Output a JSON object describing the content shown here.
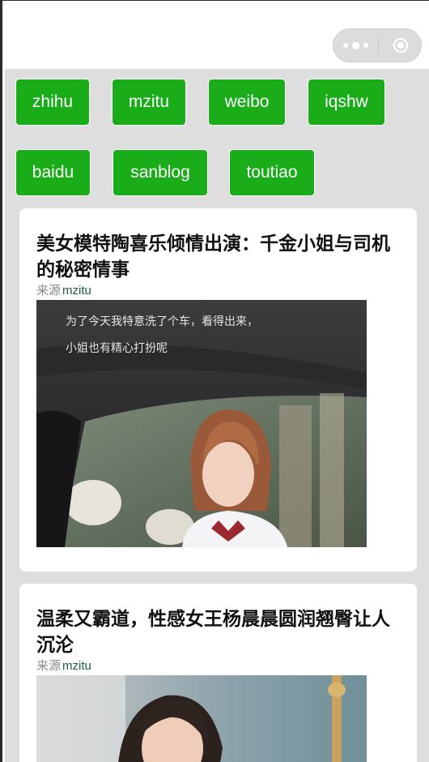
{
  "capsule": {
    "menu_icon": "more-dots-icon",
    "close_icon": "target-circle-icon"
  },
  "categories": [
    {
      "label": "zhihu"
    },
    {
      "label": "mzitu"
    },
    {
      "label": "weibo"
    },
    {
      "label": "iqshw"
    },
    {
      "label": "baidu"
    },
    {
      "label": "sanblog"
    },
    {
      "label": "toutiao"
    }
  ],
  "colors": {
    "accent_green": "#1aad19",
    "background_gray": "#dedede",
    "source_green": "#1e5e3a"
  },
  "articles": [
    {
      "title": "美女模特陶喜乐倾情出演：千金小姐与司机的秘密情事",
      "source_label": "来源",
      "source": "mzitu",
      "photo_caption_1": "为了今天我特意洗了个车，看得出来，",
      "photo_caption_2": "小姐也有精心打扮呢"
    },
    {
      "title": "温柔又霸道，性感女王杨晨晨圆润翘臀让人沉沦",
      "source_label": "来源",
      "source": "mzitu"
    }
  ]
}
